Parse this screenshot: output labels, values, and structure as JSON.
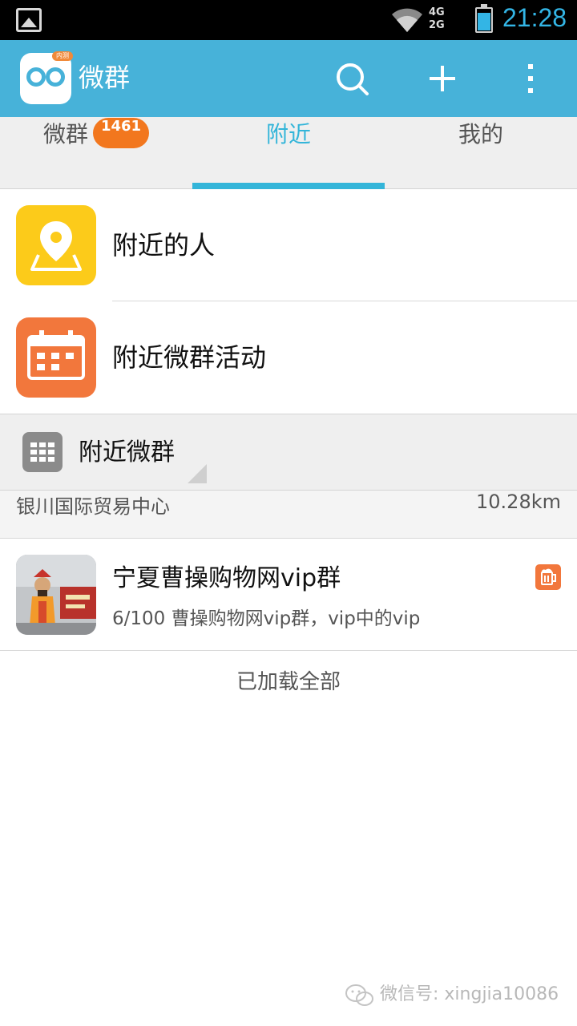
{
  "status_bar": {
    "network_top": "4G",
    "network_bottom": "2G",
    "time": "21:28"
  },
  "app": {
    "title": "微群",
    "logo_badge": "内测"
  },
  "tabs": [
    {
      "label": "微群",
      "count": "1461",
      "active": false
    },
    {
      "label": "附近",
      "active": true
    },
    {
      "label": "我的",
      "active": false
    }
  ],
  "entries": [
    {
      "label": "附近的人",
      "icon": "map-pin-icon",
      "color": "#fccb1a"
    },
    {
      "label": "附近微群活动",
      "icon": "calendar-icon",
      "color": "#f2773c"
    }
  ],
  "section": {
    "title": "附近微群",
    "icon": "grid-icon"
  },
  "location": {
    "name": "银川国际贸易中心",
    "distance": "10.28km"
  },
  "groups": [
    {
      "name": "宁夏曹操购物网vip群",
      "description": "6/100 曹操购物网vip群，vip中的vip",
      "badge_icon": "beer-icon",
      "badge_color": "#f2773c"
    }
  ],
  "footer": {
    "load_status": "已加载全部"
  },
  "watermark": {
    "text": "微信号: xingjia10086"
  },
  "colors": {
    "accent": "#47b2d9",
    "tab_active": "#33b5d9",
    "count_badge": "#f2771e"
  }
}
